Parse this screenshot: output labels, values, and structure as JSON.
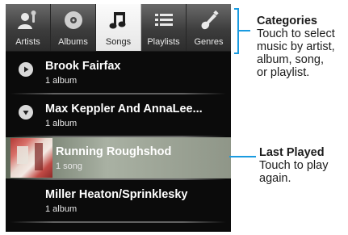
{
  "tabs": [
    {
      "label": "Artists",
      "icon": "artist-icon",
      "active": false
    },
    {
      "label": "Albums",
      "icon": "album-disc-icon",
      "active": false
    },
    {
      "label": "Songs",
      "icon": "music-note-icon",
      "active": true
    },
    {
      "label": "Playlists",
      "icon": "playlist-icon",
      "active": false
    },
    {
      "label": "Genres",
      "icon": "guitar-icon",
      "active": false
    }
  ],
  "list": [
    {
      "title": "Brook Fairfax",
      "subtitle": "1 album",
      "icon": "play-icon"
    },
    {
      "title": "Max Keppler And AnnaLee...",
      "subtitle": "1 album",
      "icon": "expand-down-icon"
    },
    {
      "title": "Running Roughshod",
      "subtitle": "1 song",
      "icon": "album-art",
      "highlighted": true
    },
    {
      "title": "Miller Heaton/Sprinklesky",
      "subtitle": "1 album",
      "icon": ""
    }
  ],
  "callouts": {
    "categories": {
      "heading": "Categories",
      "body": "Touch to select\nmusic by artist,\nalbum, song,\nor playlist."
    },
    "last_played": {
      "heading": "Last Played",
      "body": "Touch to play\nagain."
    }
  },
  "colors": {
    "callout_line": "#1a9be0",
    "screen_bg": "#0b0b0b",
    "active_tab": "#f0f0f0"
  }
}
